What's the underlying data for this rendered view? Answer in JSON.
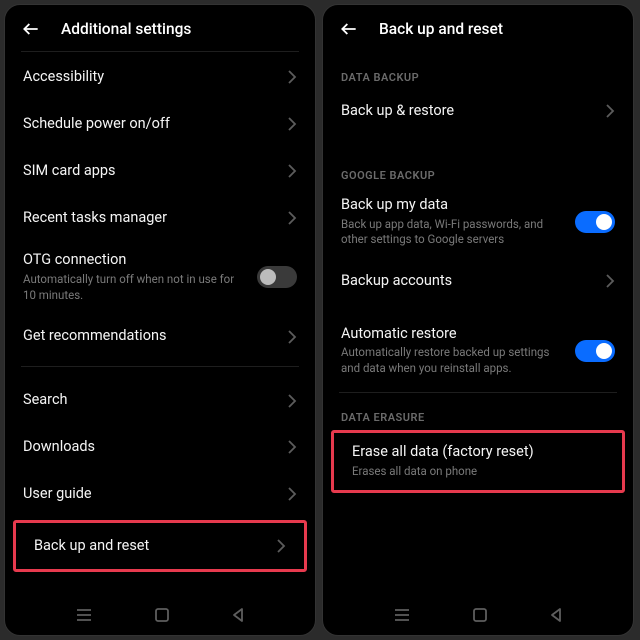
{
  "left": {
    "title": "Additional settings",
    "items": {
      "accessibility": "Accessibility",
      "schedule": "Schedule power on/off",
      "sim": "SIM card apps",
      "recent": "Recent tasks manager",
      "otg": {
        "label": "OTG connection",
        "sub": "Automatically turn off when not in use for 10 minutes."
      },
      "recommend": "Get recommendations",
      "search": "Search",
      "downloads": "Downloads",
      "guide": "User guide",
      "backup": "Back up and reset"
    }
  },
  "right": {
    "title": "Back up and reset",
    "sections": {
      "data_backup": "DATA BACKUP",
      "google_backup": "GOOGLE BACKUP",
      "data_erasure": "DATA ERASURE"
    },
    "items": {
      "restore": "Back up & restore",
      "my_data": {
        "label": "Back up my data",
        "sub": "Back up app data, Wi-Fi passwords, and other settings to Google servers"
      },
      "accounts": "Backup accounts",
      "auto": {
        "label": "Automatic restore",
        "sub": "Automatically restore backed up settings and data when you reinstall apps."
      },
      "erase": {
        "label": "Erase all data (factory reset)",
        "sub": "Erases all data on phone"
      }
    }
  }
}
